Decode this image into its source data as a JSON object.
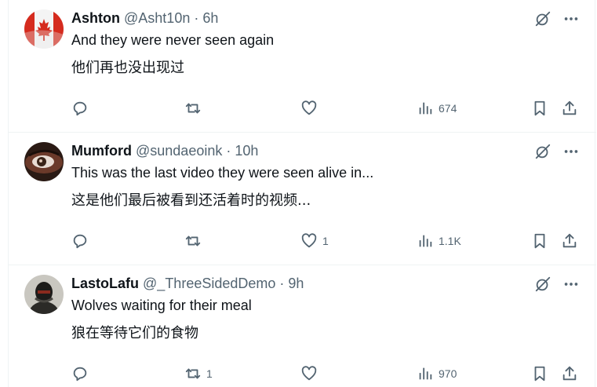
{
  "colors": {
    "text": "#0f1419",
    "muted": "#536471",
    "border": "#eff3f4"
  },
  "replies": [
    {
      "name": "Ashton",
      "handle": "@Asht10n",
      "sep": "·",
      "time": "6h",
      "text_en": "And they were never seen again",
      "text_zh": "他们再也没出现过",
      "reply_count": "",
      "retweet_count": "",
      "like_count": "",
      "views": "674",
      "avatar": "canada-flag"
    },
    {
      "name": "Mumford",
      "handle": "@sundaeoink",
      "sep": "·",
      "time": "10h",
      "text_en": "This was the last video they were seen alive in...",
      "text_zh": "这是他们最后被看到还活着时的视频...",
      "reply_count": "",
      "retweet_count": "",
      "like_count": "1",
      "views": "1.1K",
      "avatar": "eye-closeup"
    },
    {
      "name": "LastoLafu",
      "handle": "@_ThreeSidedDemo",
      "sep": "·",
      "time": "9h",
      "text_en": "Wolves waiting for their meal",
      "text_zh": "狼在等待它们的食物",
      "reply_count": "",
      "retweet_count": "1",
      "like_count": "",
      "views": "970",
      "avatar": "armored-figure"
    }
  ]
}
